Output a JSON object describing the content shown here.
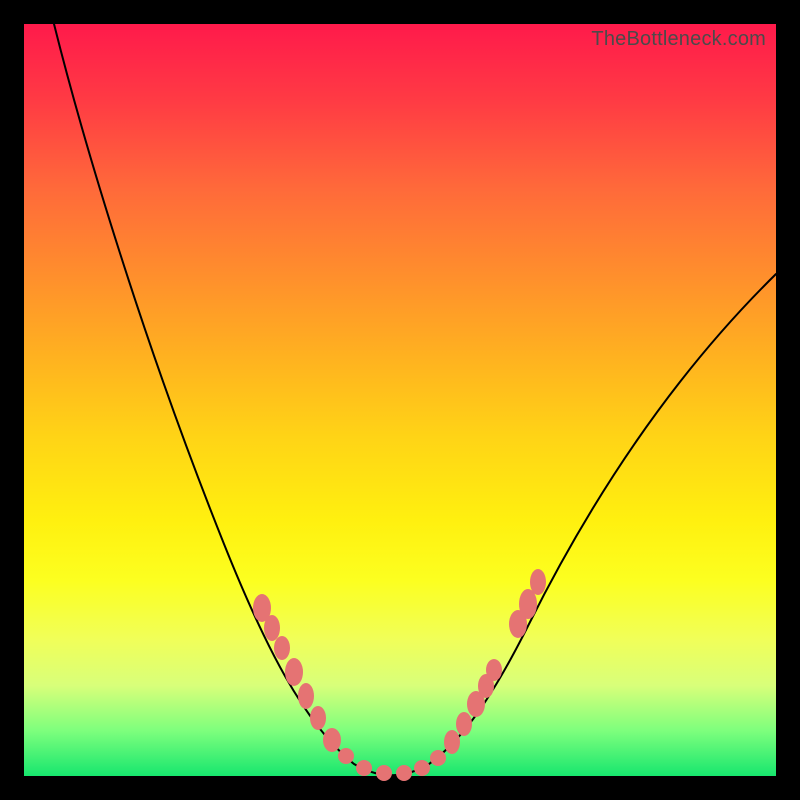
{
  "watermark": "TheBottleneck.com",
  "colors": {
    "frame": "#000000",
    "marker": "#e57373",
    "curve": "#000000"
  },
  "chart_data": {
    "type": "line",
    "title": "",
    "xlabel": "",
    "ylabel": "",
    "xlim": [
      0,
      100
    ],
    "ylim": [
      0,
      100
    ],
    "grid": false,
    "legend": false,
    "series": [
      {
        "name": "bottleneck-curve",
        "x": [
          4,
          8,
          12,
          16,
          20,
          24,
          28,
          32,
          35,
          38,
          40,
          42,
          44,
          46,
          48,
          50,
          52,
          55,
          58,
          62,
          66,
          72,
          80,
          90,
          100
        ],
        "y": [
          100,
          90,
          80,
          70,
          60,
          50,
          40,
          30,
          22,
          15,
          10,
          6,
          3,
          1.5,
          0.7,
          0.3,
          0.7,
          2.5,
          6,
          12,
          20,
          30,
          42,
          55,
          67
        ]
      }
    ],
    "markers_left_branch": {
      "name": "left-branch-salmon-markers",
      "x": [
        32,
        33,
        34,
        35.5,
        37,
        38.5,
        40
      ],
      "y": [
        30,
        27,
        24,
        20,
        16,
        12,
        9
      ]
    },
    "markers_right_branch": {
      "name": "right-branch-salmon-markers",
      "x": [
        55,
        56,
        57.5,
        59,
        60.5,
        62
      ],
      "y": [
        3,
        5,
        8,
        11,
        14,
        18
      ]
    },
    "markers_valley": {
      "name": "valley-salmon-markers",
      "x": [
        42,
        44,
        46,
        48,
        50,
        52
      ],
      "y": [
        4,
        2,
        1,
        0.5,
        0.7,
        1.8
      ]
    }
  }
}
